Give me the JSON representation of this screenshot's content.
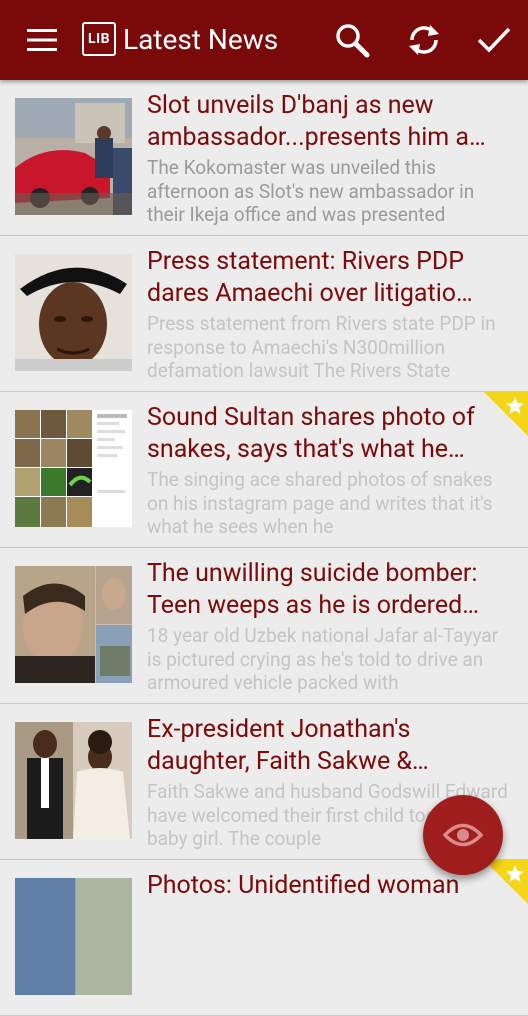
{
  "app": {
    "logo_text": "LIB",
    "title": "Latest News"
  },
  "colors": {
    "toolbar": "#7a0a0a",
    "title_text": "#7a0a0a",
    "excerpt_text": "#9a9a9a",
    "fab": "#a01d1d",
    "ribbon": "#f5d518"
  },
  "toolbar_icons": [
    "menu-icon",
    "search-icon",
    "refresh-icon",
    "check-icon"
  ],
  "articles": [
    {
      "title": "Slot unveils D'banj as new ambassador...presents him a…",
      "excerpt": "The Kokomaster was unveiled this afternoon as Slot's new ambassador in their Ikeja office and was presented",
      "starred": false,
      "read": false
    },
    {
      "title": "Press statement: Rivers PDP dares Amaechi over litigatio…",
      "excerpt": "Press statement from Rivers state PDP in response to Amaechi's N300million defamation lawsuit The Rivers State",
      "starred": false,
      "read": true
    },
    {
      "title": "Sound Sultan shares photo of snakes, says that's what he…",
      "excerpt": "The singing ace shared photos of snakes on his instagram page and writes that it's what he sees when he",
      "starred": true,
      "read": true
    },
    {
      "title": "The unwilling suicide bomber: Teen weeps as he is ordered…",
      "excerpt": "18 year old Uzbek national Jafar al-Tayyar is pictured crying as he's told to drive an armoured vehicle packed with",
      "starred": false,
      "read": true
    },
    {
      "title": "Ex-president Jonathan's daughter, Faith Sakwe &…",
      "excerpt": "Faith Sakwe and husband Godswill Edward have welcomed their first child together, a baby girl. The couple",
      "starred": false,
      "read": true
    },
    {
      "title": "Photos: Unidentified woman",
      "excerpt": "",
      "starred": true,
      "read": true
    }
  ],
  "fab": {
    "icon": "eye-icon"
  }
}
